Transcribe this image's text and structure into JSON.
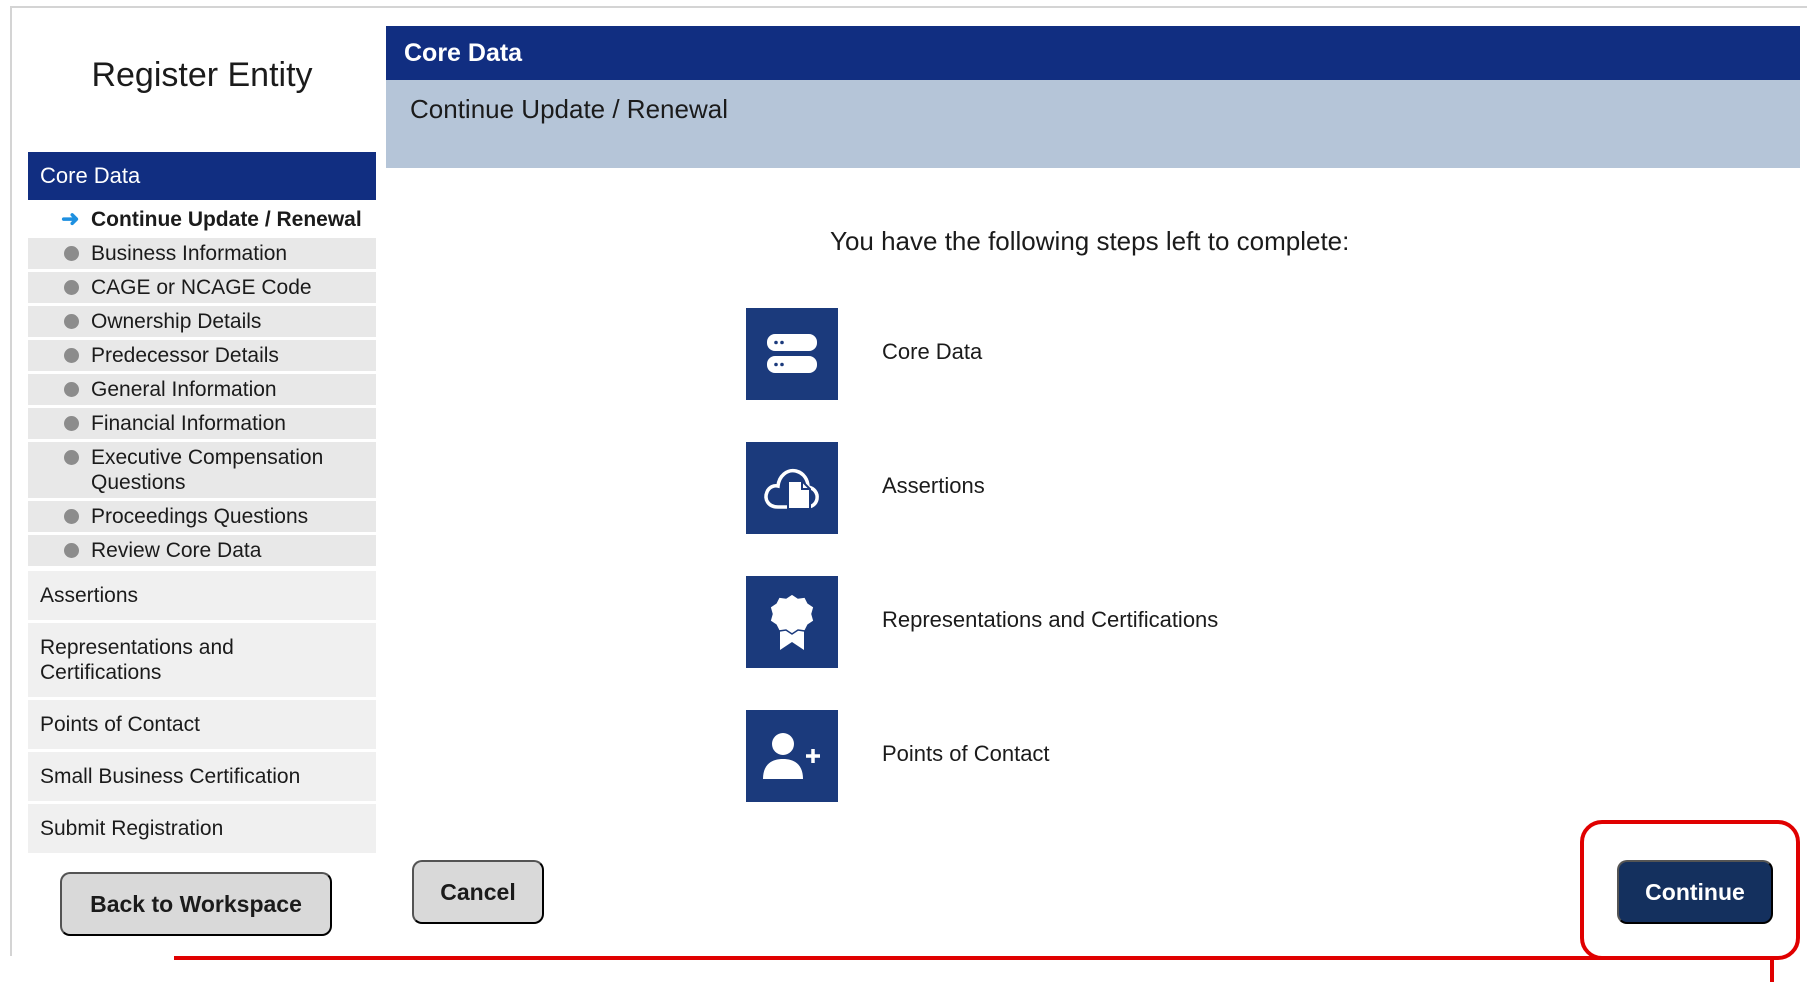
{
  "sidebar": {
    "title": "Register Entity",
    "active_section": "Core Data",
    "subitems": [
      {
        "label": "Continue Update / Renewal",
        "current": true
      },
      {
        "label": "Business Information"
      },
      {
        "label": "CAGE or NCAGE Code"
      },
      {
        "label": "Ownership Details"
      },
      {
        "label": "Predecessor Details"
      },
      {
        "label": "General Information"
      },
      {
        "label": "Financial Information"
      },
      {
        "label": "Executive Compensation Questions"
      },
      {
        "label": "Proceedings Questions"
      },
      {
        "label": "Review Core Data"
      }
    ],
    "sections": [
      "Assertions",
      "Representations and Certifications",
      "Points of Contact",
      "Small Business Certification",
      "Submit Registration"
    ]
  },
  "main": {
    "header": "Core Data",
    "subheader": "Continue Update / Renewal",
    "intro": "You have the following steps left to complete:",
    "steps": [
      {
        "label": "Core Data",
        "icon": "server-icon"
      },
      {
        "label": "Assertions",
        "icon": "cloud-document-icon"
      },
      {
        "label": "Representations and Certifications",
        "icon": "badge-ribbon-icon"
      },
      {
        "label": "Points of Contact",
        "icon": "add-user-icon"
      }
    ]
  },
  "buttons": {
    "back": "Back to Workspace",
    "cancel": "Cancel",
    "continue": "Continue"
  },
  "colors": {
    "header_navy": "#112e81",
    "subheader_blue": "#b5c5d8",
    "icon_tile": "#1b3a7c",
    "continue_button": "#14305e",
    "highlight_red": "#e00000"
  }
}
